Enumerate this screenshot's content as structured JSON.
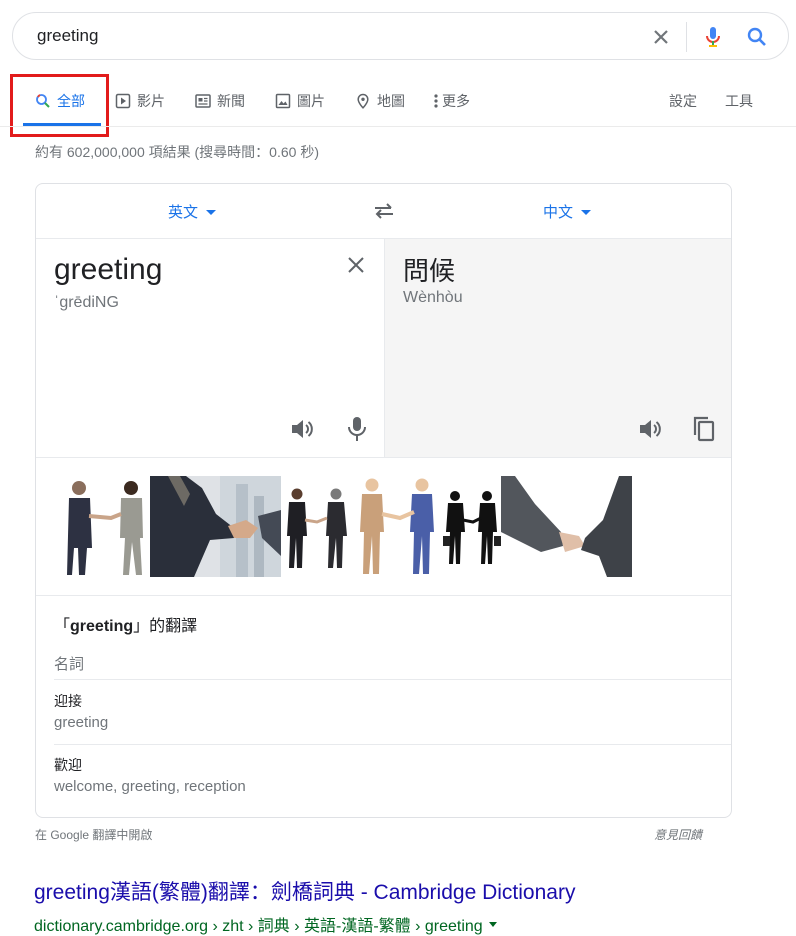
{
  "search": {
    "query": "greeting"
  },
  "tabs": [
    {
      "label": "全部",
      "icon": "search-icon"
    },
    {
      "label": "影片",
      "icon": "video-icon"
    },
    {
      "label": "新聞",
      "icon": "news-icon"
    },
    {
      "label": "圖片",
      "icon": "image-icon"
    },
    {
      "label": "地圖",
      "icon": "map-pin-icon"
    },
    {
      "label": "更多",
      "icon": "more-vert-icon"
    }
  ],
  "tools": {
    "settings": "設定",
    "tools": "工具"
  },
  "stats": "約有 602,000,000 項結果 (搜尋時間：0.60 秒)",
  "translate": {
    "source_lang": "英文",
    "target_lang": "中文",
    "source_word": "greeting",
    "source_pron": "ˈɡrēdiNG",
    "target_word": "問候",
    "target_pron": "Wènhòu",
    "translations_title_pre": "「",
    "translations_title_word": "greeting",
    "translations_title_post": "」的翻譯",
    "part_of_speech": "名詞",
    "entries": [
      {
        "word": "迎接",
        "synonyms": "greeting"
      },
      {
        "word": "歡迎",
        "synonyms": "welcome, greeting, reception"
      }
    ]
  },
  "footer": {
    "open_in_translate": "在 Google 翻譯中開啟",
    "feedback": "意見回饋"
  },
  "result": {
    "title": "greeting漢語(繁體)翻譯：劍橋詞典 - Cambridge Dictionary",
    "url": "dictionary.cambridge.org › zht › 詞典 › 英語-漢語-繁體 › greeting"
  },
  "colors": {
    "accent": "#1a73e8",
    "highlight_box": "#e21b1b",
    "link": "#1a0dab",
    "url": "#006621"
  }
}
